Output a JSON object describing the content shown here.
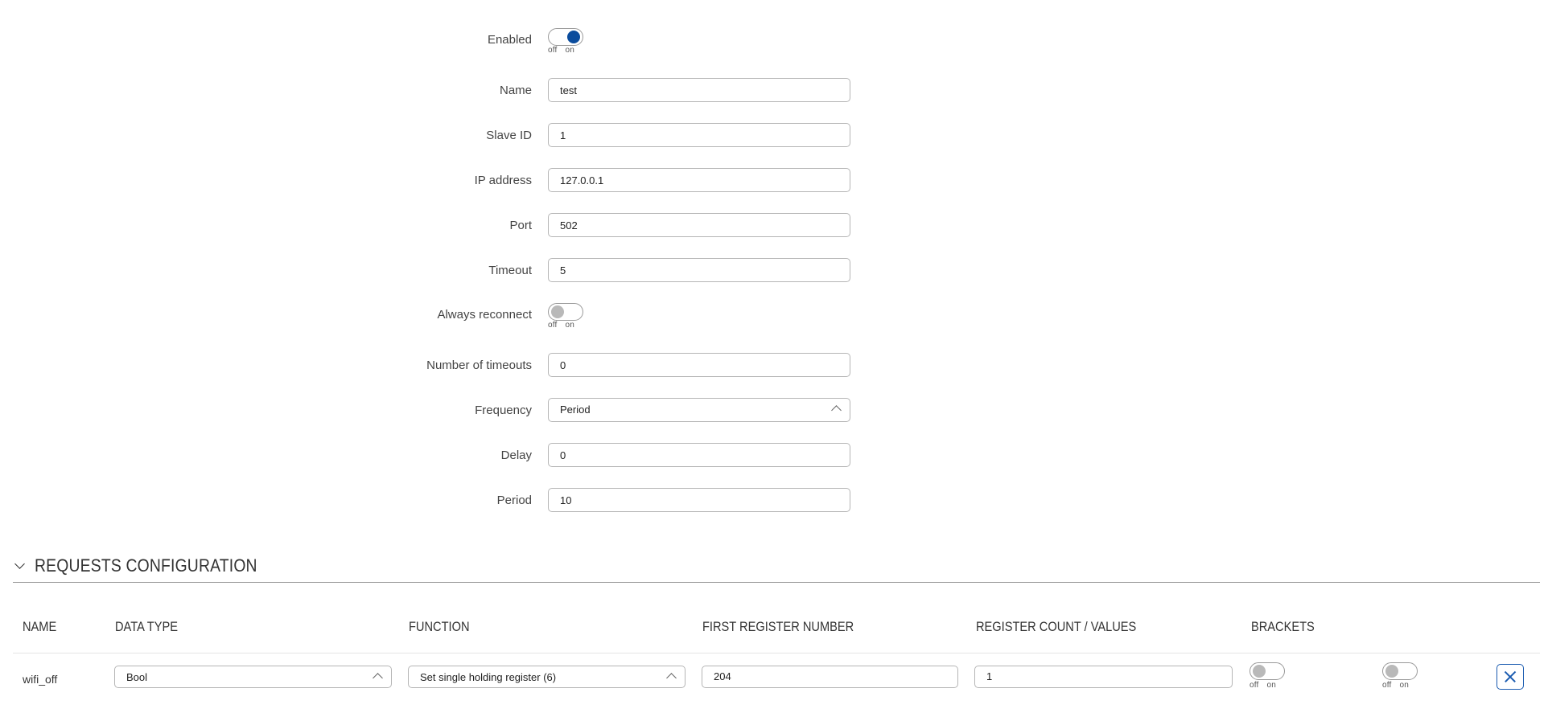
{
  "form": {
    "enabled": {
      "label": "Enabled",
      "state": "on",
      "off_text": "off",
      "on_text": "on"
    },
    "name": {
      "label": "Name",
      "value": "test"
    },
    "slave_id": {
      "label": "Slave ID",
      "value": "1"
    },
    "ip_address": {
      "label": "IP address",
      "value": "127.0.0.1"
    },
    "port": {
      "label": "Port",
      "value": "502"
    },
    "timeout": {
      "label": "Timeout",
      "value": "5"
    },
    "always_reconnect": {
      "label": "Always reconnect",
      "state": "off",
      "off_text": "off",
      "on_text": "on"
    },
    "number_of_timeouts": {
      "label": "Number of timeouts",
      "value": "0"
    },
    "frequency": {
      "label": "Frequency",
      "value": "Period"
    },
    "delay": {
      "label": "Delay",
      "value": "0"
    },
    "period": {
      "label": "Period",
      "value": "10"
    }
  },
  "requests": {
    "section_title": "REQUESTS CONFIGURATION",
    "columns": [
      "NAME",
      "DATA TYPE",
      "FUNCTION",
      "FIRST REGISTER NUMBER",
      "REGISTER COUNT / VALUES",
      "BRACKETS"
    ],
    "rows": [
      {
        "name": "wifi_off",
        "data_type": "Bool",
        "function": "Set single holding register (6)",
        "first_register_number": "204",
        "register_count": "1",
        "brackets_toggle": {
          "state": "off",
          "off_text": "off",
          "on_text": "on"
        },
        "enable_toggle": {
          "state": "off",
          "off_text": "off",
          "on_text": "on"
        }
      }
    ]
  },
  "icons": {
    "select_chevron": "chevron-up-icon",
    "section_chevron": "chevron-down-icon",
    "delete": "close-icon"
  },
  "colors": {
    "accent": "#0b4c9d",
    "toggle_off_knob": "#b9b9b9",
    "delete_button": "#1a5bb0"
  }
}
